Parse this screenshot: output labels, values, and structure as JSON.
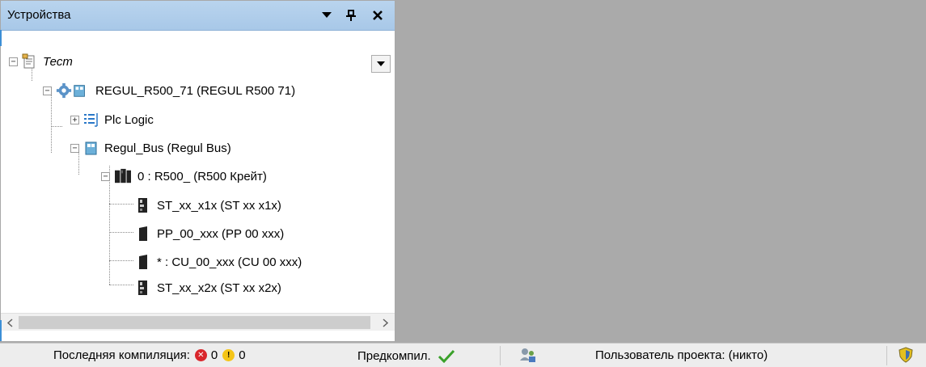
{
  "panel": {
    "title": "Устройства",
    "buttons": {
      "menu": "▾",
      "pin": "ᵠ",
      "close": "✕"
    }
  },
  "tree": [
    {
      "label": "Тест",
      "italic": true,
      "icon": "project-icon"
    },
    {
      "label": "REGUL_R500_71 (REGUL R500 71)",
      "icon": "plc-device-icon"
    },
    {
      "label": "Plc Logic",
      "icon": "plc-logic-icon"
    },
    {
      "label": "Regul_Bus (Regul Bus)",
      "icon": "bus-icon"
    },
    {
      "label": "0 : R500_ (R500 Крейт)",
      "icon": "rack-icon"
    },
    {
      "label": "ST_xx_x1x (ST xx x1x)",
      "icon": "module-icon"
    },
    {
      "label": "PP_00_xxx (PP 00 xxx)",
      "icon": "module-icon"
    },
    {
      "label": "* : CU_00_xxx (CU 00 xxx)",
      "icon": "module-icon"
    },
    {
      "label": "ST_xx_x2x (ST xx x2x)",
      "icon": "module-icon"
    }
  ],
  "statusbar": {
    "last_compile_label": "Последняя компиляция:",
    "errors": "0",
    "warnings": "0",
    "precompile_label": "Предкомпил.",
    "project_user_label": "Пользователь проекта: (никто)"
  },
  "colors": {
    "titlebar": "#b3d0ec",
    "error": "#d9262b",
    "warning": "#f5c518",
    "ok": "#3aa12a"
  }
}
